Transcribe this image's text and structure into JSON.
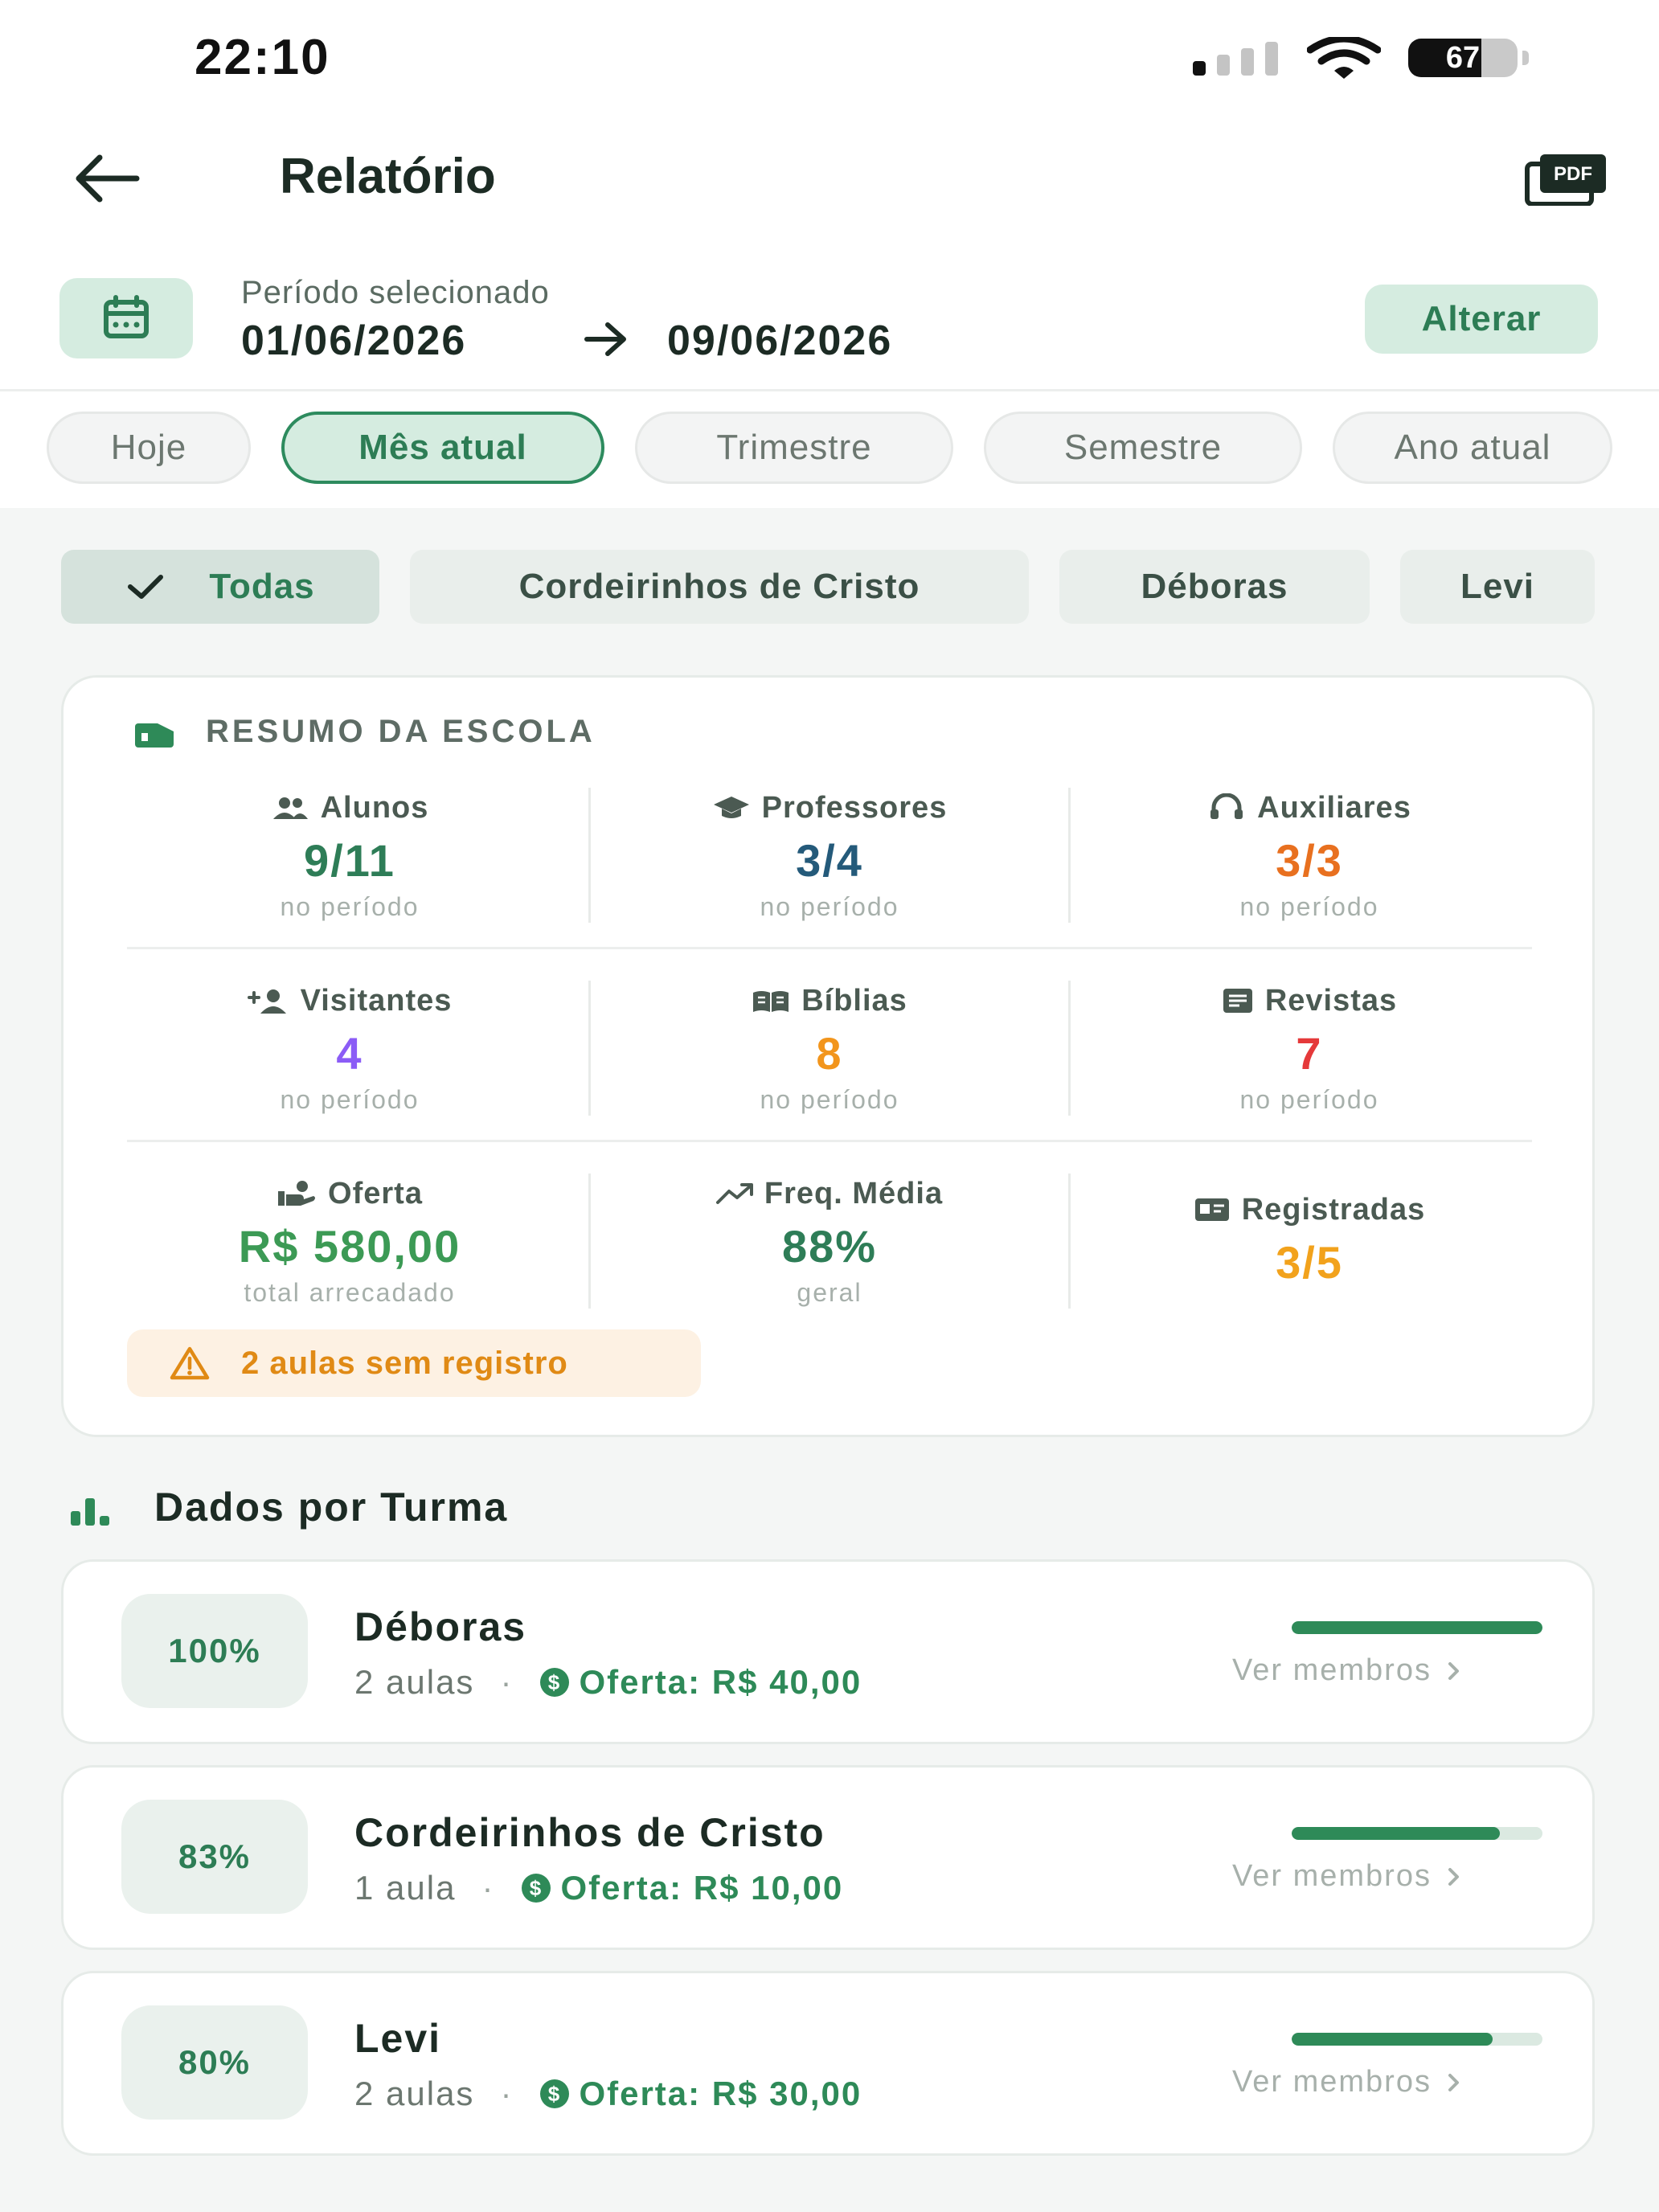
{
  "status_bar": {
    "time": "22:10",
    "battery": "67",
    "battery_level": 0.67
  },
  "header": {
    "title": "Relatório",
    "back_icon": "arrow-left-icon",
    "pdf_icon": "pdf-icon",
    "pdf_label": "PDF"
  },
  "period": {
    "label": "Período selecionado",
    "start": "01/06/2026",
    "end": "09/06/2026",
    "change_label": "Alterar"
  },
  "period_chips": [
    {
      "label": "Hoje",
      "active": false
    },
    {
      "label": "Mês atual",
      "active": true
    },
    {
      "label": "Trimestre",
      "active": false
    },
    {
      "label": "Semestre",
      "active": false
    },
    {
      "label": "Ano atual",
      "active": false
    }
  ],
  "class_filters": [
    {
      "label": "Todas",
      "active": true
    },
    {
      "label": "Cordeirinhos de Cristo",
      "active": false
    },
    {
      "label": "Déboras",
      "active": false
    },
    {
      "label": "Levi",
      "active": false
    }
  ],
  "summary": {
    "title": "RESUMO DA ESCOLA",
    "stats": [
      {
        "label": "Alunos",
        "value": "9/11",
        "sub": "no período",
        "color": "#2e7d57",
        "icon": "users-icon"
      },
      {
        "label": "Professores",
        "value": "3/4",
        "sub": "no período",
        "color": "#245a7a",
        "icon": "graduation-cap-icon"
      },
      {
        "label": "Auxiliares",
        "value": "3/3",
        "sub": "no período",
        "color": "#e8701f",
        "icon": "headset-icon"
      },
      {
        "label": "Visitantes",
        "value": "4",
        "sub": "no período",
        "color": "#8b5cf6",
        "icon": "person-add-icon"
      },
      {
        "label": "Bíblias",
        "value": "8",
        "sub": "no período",
        "color": "#f2951c",
        "icon": "book-open-icon"
      },
      {
        "label": "Revistas",
        "value": "7",
        "sub": "no período",
        "color": "#e5393a",
        "icon": "magazine-icon"
      },
      {
        "label": "Oferta",
        "value": "R$ 580,00",
        "sub": "total arrecadado",
        "color": "#3c9a55",
        "icon": "hand-coin-icon"
      },
      {
        "label": "Freq. Média",
        "value": "88%",
        "sub": "geral",
        "color": "#2e7d57",
        "icon": "trending-up-icon"
      },
      {
        "label": "Registradas",
        "value": "3/5",
        "sub": "",
        "color": "#f2a21c",
        "icon": "id-card-icon"
      }
    ],
    "warning": "2 aulas sem registro"
  },
  "section": {
    "title": "Dados por Turma"
  },
  "classes": [
    {
      "percent_label": "100%",
      "percent": 100,
      "name": "Déboras",
      "lessons": "2 aulas",
      "offer": "Oferta: R$ 40,00",
      "link": "Ver membros"
    },
    {
      "percent_label": "83%",
      "percent": 83,
      "name": "Cordeirinhos de Cristo",
      "lessons": "1 aula",
      "offer": "Oferta: R$ 10,00",
      "link": "Ver membros"
    },
    {
      "percent_label": "80%",
      "percent": 80,
      "name": "Levi",
      "lessons": "2 aulas",
      "offer": "Oferta: R$ 30,00",
      "link": "Ver membros"
    }
  ],
  "colors": {
    "accent": "#2e8a58",
    "accent_soft": "#d5ece0",
    "warning": "#e08a15"
  }
}
